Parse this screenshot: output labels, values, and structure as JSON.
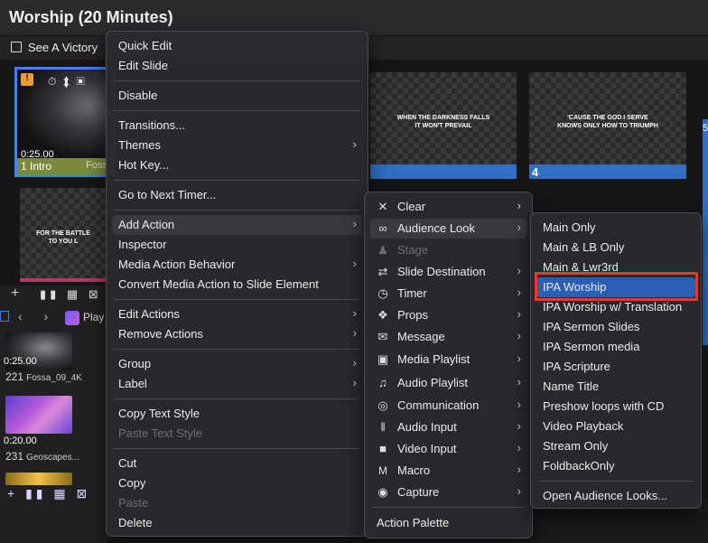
{
  "window": {
    "title": "Worship (20 Minutes)"
  },
  "presentation": {
    "playlist_label": "See A Victory"
  },
  "slides": [
    {
      "number": "1",
      "label": "Intro",
      "time": "0:25.00",
      "group": "Foss"
    },
    {
      "number": "",
      "lyric_line1": "WHEN THE DARKNESS FALLS",
      "lyric_line2": "IT WON'T PREVAIL"
    },
    {
      "number": "4",
      "lyric_line1": "'CAUSE THE GOD I SERVE",
      "lyric_line2": "KNOWS ONLY HOW TO TRIUMPH"
    },
    {
      "number": "5"
    },
    {
      "lyric_line1": "FOR THE BATTLE",
      "lyric_line2": "TO YOU L"
    }
  ],
  "media_bin": {
    "playlist_label": "Play",
    "items": [
      {
        "time": "0:25.00",
        "id": "221",
        "name": "Fossa_09_4K"
      },
      {
        "time": "0:20.00",
        "id": "231",
        "name": "Geoscapes..."
      }
    ]
  },
  "context_menu": {
    "items": [
      {
        "label": "Quick Edit"
      },
      {
        "label": "Edit Slide"
      },
      {
        "label": "Disable"
      },
      {
        "label": "Transitions..."
      },
      {
        "label": "Themes"
      },
      {
        "label": "Hot Key..."
      },
      {
        "label": "Go to Next Timer..."
      },
      {
        "label": "Add Action"
      },
      {
        "label": "Inspector"
      },
      {
        "label": "Media Action Behavior"
      },
      {
        "label": "Convert Media Action to Slide Element"
      },
      {
        "label": "Edit Actions"
      },
      {
        "label": "Remove Actions"
      },
      {
        "label": "Group"
      },
      {
        "label": "Label"
      },
      {
        "label": "Copy Text Style"
      },
      {
        "label": "Paste Text Style"
      },
      {
        "label": "Cut"
      },
      {
        "label": "Copy"
      },
      {
        "label": "Paste"
      },
      {
        "label": "Delete"
      }
    ]
  },
  "add_action_menu": {
    "items": [
      {
        "label": "Clear",
        "icon": "clear-icon"
      },
      {
        "label": "Audience Look",
        "icon": "mask-icon"
      },
      {
        "label": "Stage",
        "icon": "stage-icon"
      },
      {
        "label": "Slide Destination",
        "icon": "slide-destination-icon"
      },
      {
        "label": "Timer",
        "icon": "timer-icon"
      },
      {
        "label": "Props",
        "icon": "props-icon"
      },
      {
        "label": "Message",
        "icon": "message-icon"
      },
      {
        "label": "Media Playlist",
        "icon": "media-playlist-icon"
      },
      {
        "label": "Audio Playlist",
        "icon": "audio-playlist-icon"
      },
      {
        "label": "Communication",
        "icon": "communication-icon"
      },
      {
        "label": "Audio Input",
        "icon": "audio-input-icon"
      },
      {
        "label": "Video Input",
        "icon": "video-input-icon"
      },
      {
        "label": "Macro",
        "icon": "macro-icon"
      },
      {
        "label": "Capture",
        "icon": "capture-icon"
      },
      {
        "label": "Action Palette"
      }
    ]
  },
  "audience_look_menu": {
    "items": [
      {
        "label": "Main Only"
      },
      {
        "label": "Main & LB Only"
      },
      {
        "label": "Main & Lwr3rd"
      },
      {
        "label": "IPA Worship"
      },
      {
        "label": "IPA Worship w/ Translation"
      },
      {
        "label": "IPA Sermon Slides"
      },
      {
        "label": "IPA Sermon media"
      },
      {
        "label": "IPA Scripture"
      },
      {
        "label": "Name Title"
      },
      {
        "label": "Preshow loops with CD"
      },
      {
        "label": "Video Playback"
      },
      {
        "label": "Stream Only"
      },
      {
        "label": "FoldbackOnly"
      },
      {
        "label": "Open Audience Looks..."
      }
    ]
  },
  "colors": {
    "highlight": "#2b5fb3",
    "selection_outline": "#e23b2b",
    "slide_footer": "#2f6fc4"
  }
}
